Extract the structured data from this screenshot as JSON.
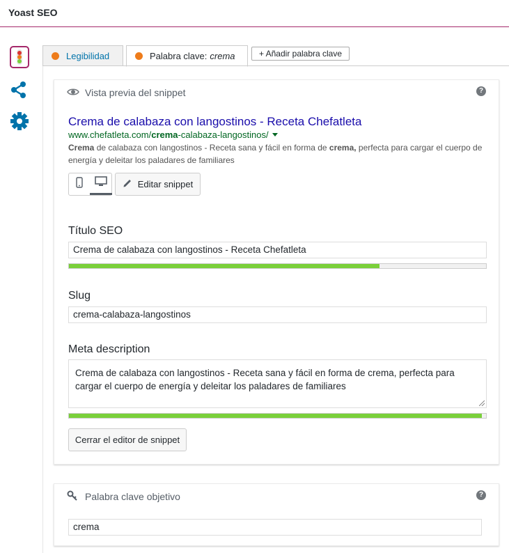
{
  "header": {
    "title": "Yoast SEO"
  },
  "sidebar": {
    "icons": [
      "traffic-light-icon",
      "share-icon",
      "gear-icon"
    ],
    "traffic_light_colors": [
      "#dc3232",
      "#ee7c1b",
      "#7ad03a"
    ]
  },
  "tabs": {
    "readability": {
      "label": "Legibilidad",
      "status_color": "#ee7c1b"
    },
    "keyword": {
      "label": "Palabra clave:",
      "keyword": "crema",
      "status_color": "#ee7c1b"
    },
    "add_keyword_label": "+ Añadir palabra clave"
  },
  "snippet": {
    "heading": "Vista previa del snippet",
    "help": "?",
    "preview": {
      "title": "Crema de calabaza con langostinos - Receta Chefatleta",
      "url_domain": "www.chefatleta.com/",
      "url_bold": "crema",
      "url_rest": "-calabaza-langostinos/",
      "desc_bold_1": "Crema",
      "desc_part_1": " de calabaza con langostinos - Receta sana y fácil en forma de ",
      "desc_bold_2": "crema,",
      "desc_part_2": " perfecta para cargar el cuerpo de energía y deleitar los paladares de familiares"
    },
    "edit_button": "Editar snippet",
    "seo_title_label": "Título SEO",
    "seo_title_value": "Crema de calabaza con langostinos - Receta Chefatleta",
    "seo_title_progress": 0.745,
    "slug_label": "Slug",
    "slug_value": "crema-calabaza-langostinos",
    "meta_label": "Meta description",
    "meta_value": "Crema de calabaza con langostinos - Receta sana y fácil en forma de crema, perfecta para cargar el cuerpo de energía y deleitar los paladares de familiares",
    "meta_progress": 0.99,
    "close_button": "Cerrar el editor de snippet"
  },
  "focus_keyword": {
    "heading": "Palabra clave objetivo",
    "help": "?",
    "value": "crema"
  },
  "colors": {
    "accent": "#a4286a",
    "link": "#0073aa",
    "serp_title": "#1a0dab",
    "serp_url": "#006621",
    "progress_green": "#7ad03a",
    "bullet_orange": "#ee7c1b"
  }
}
